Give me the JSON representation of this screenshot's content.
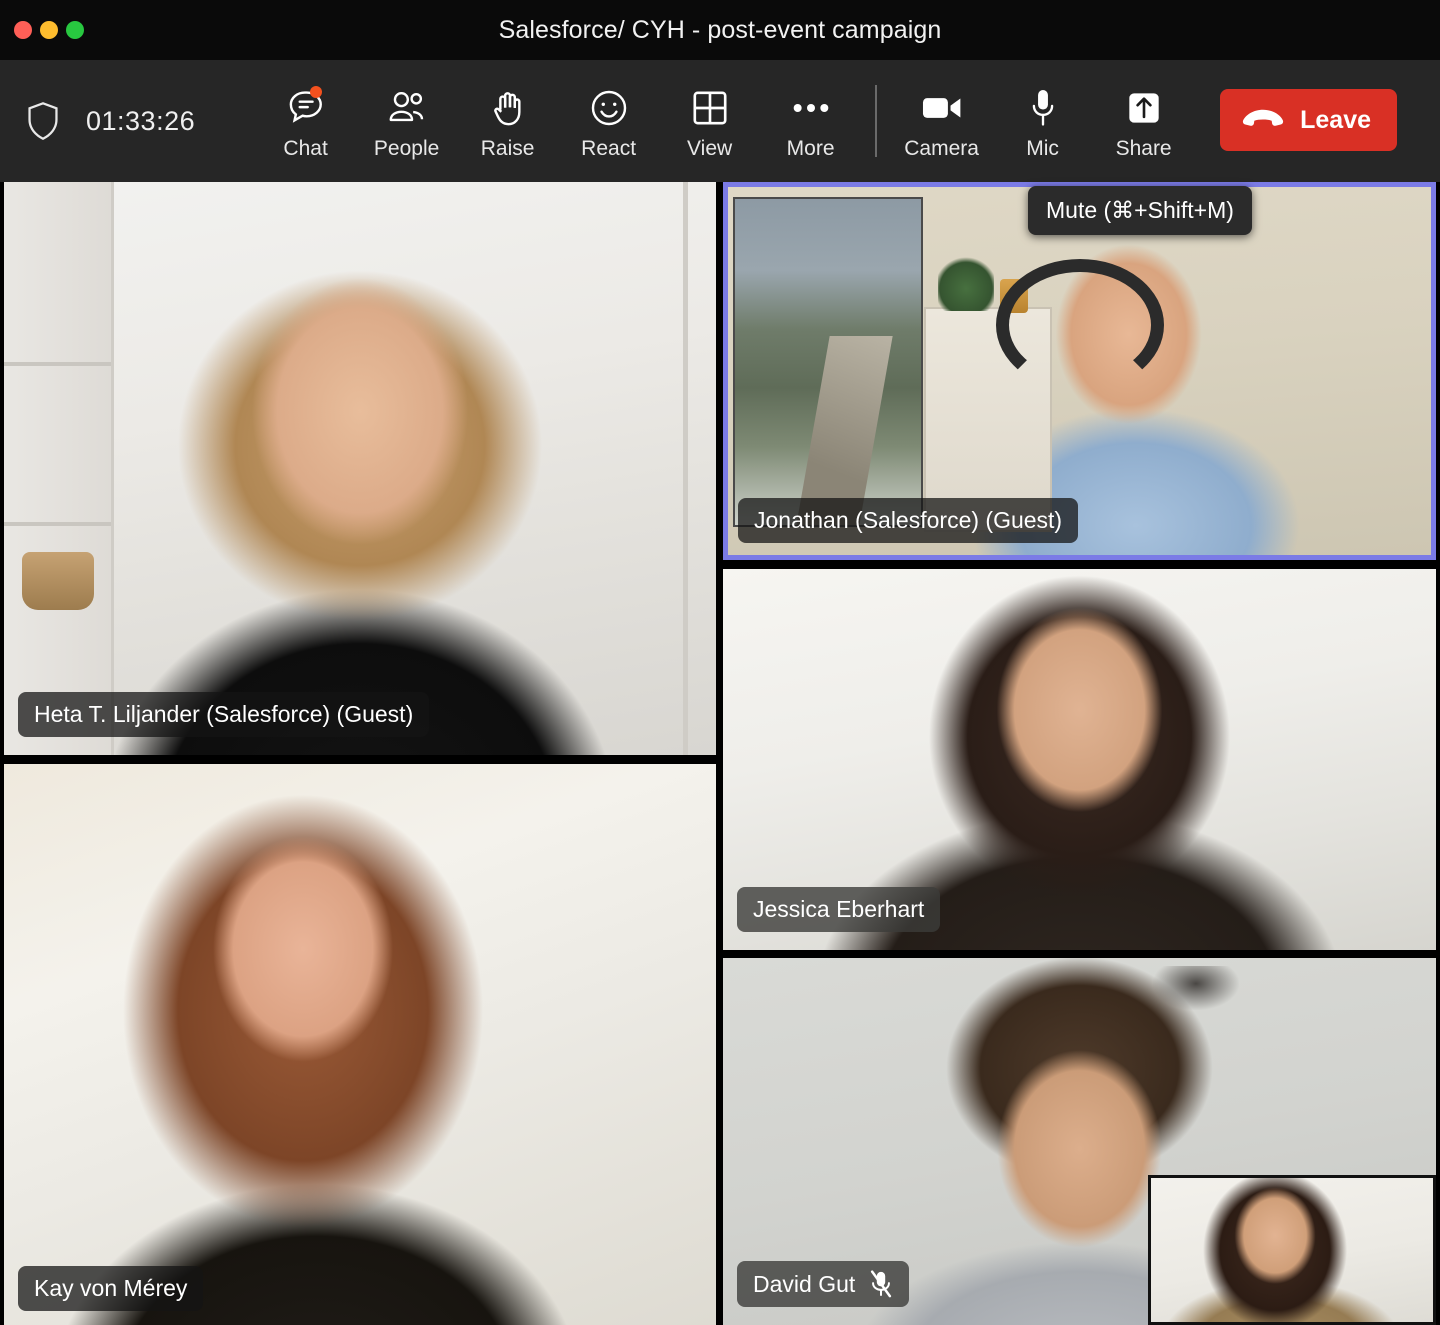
{
  "window": {
    "title": "Salesforce/ CYH - post-event campaign",
    "traffic_lights": [
      {
        "name": "close",
        "color": "#FF5F57"
      },
      {
        "name": "minimize",
        "color": "#FEBC2E"
      },
      {
        "name": "maximize",
        "color": "#28C840"
      }
    ]
  },
  "toolbar": {
    "shield_icon": "shield-icon",
    "timer": "01:33:26",
    "items": [
      {
        "label": "Chat",
        "icon": "chat-icon",
        "badge": true,
        "badge_color": "#F4511E"
      },
      {
        "label": "People",
        "icon": "people-icon",
        "badge": false
      },
      {
        "label": "Raise",
        "icon": "raise-hand-icon",
        "badge": false
      },
      {
        "label": "React",
        "icon": "react-smiley-icon",
        "badge": false
      },
      {
        "label": "View",
        "icon": "view-grid-icon",
        "badge": false
      },
      {
        "label": "More",
        "icon": "more-dots-icon",
        "badge": false
      }
    ],
    "device_items": [
      {
        "label": "Camera",
        "icon": "camera-icon"
      },
      {
        "label": "Mic",
        "icon": "mic-icon"
      },
      {
        "label": "Share",
        "icon": "share-up-arrow-icon"
      }
    ],
    "leave": {
      "label": "Leave",
      "icon": "hangup-phone-icon",
      "color": "#d93025"
    }
  },
  "tooltip": {
    "text": "Mute (⌘+Shift+M)",
    "target": "Mic"
  },
  "grid": {
    "active_speaker_color": "#7b7be6",
    "participants": [
      {
        "name": "Heta T. Liljander (Salesforce) (Guest)",
        "muted": false,
        "active_speaker": false,
        "position": "left-top"
      },
      {
        "name": "Kay von Mérey",
        "muted": false,
        "active_speaker": false,
        "position": "left-bottom"
      },
      {
        "name": "Jonathan (Salesforce) (Guest)",
        "muted": false,
        "active_speaker": true,
        "position": "right-top"
      },
      {
        "name": "Jessica Eberhart",
        "muted": false,
        "active_speaker": false,
        "position": "right-middle"
      },
      {
        "name": "David Gut",
        "muted": true,
        "mute_icon": "mic-muted-icon",
        "active_speaker": false,
        "position": "right-bottom"
      }
    ],
    "self_view": {
      "name": "",
      "label_visible": false
    }
  }
}
